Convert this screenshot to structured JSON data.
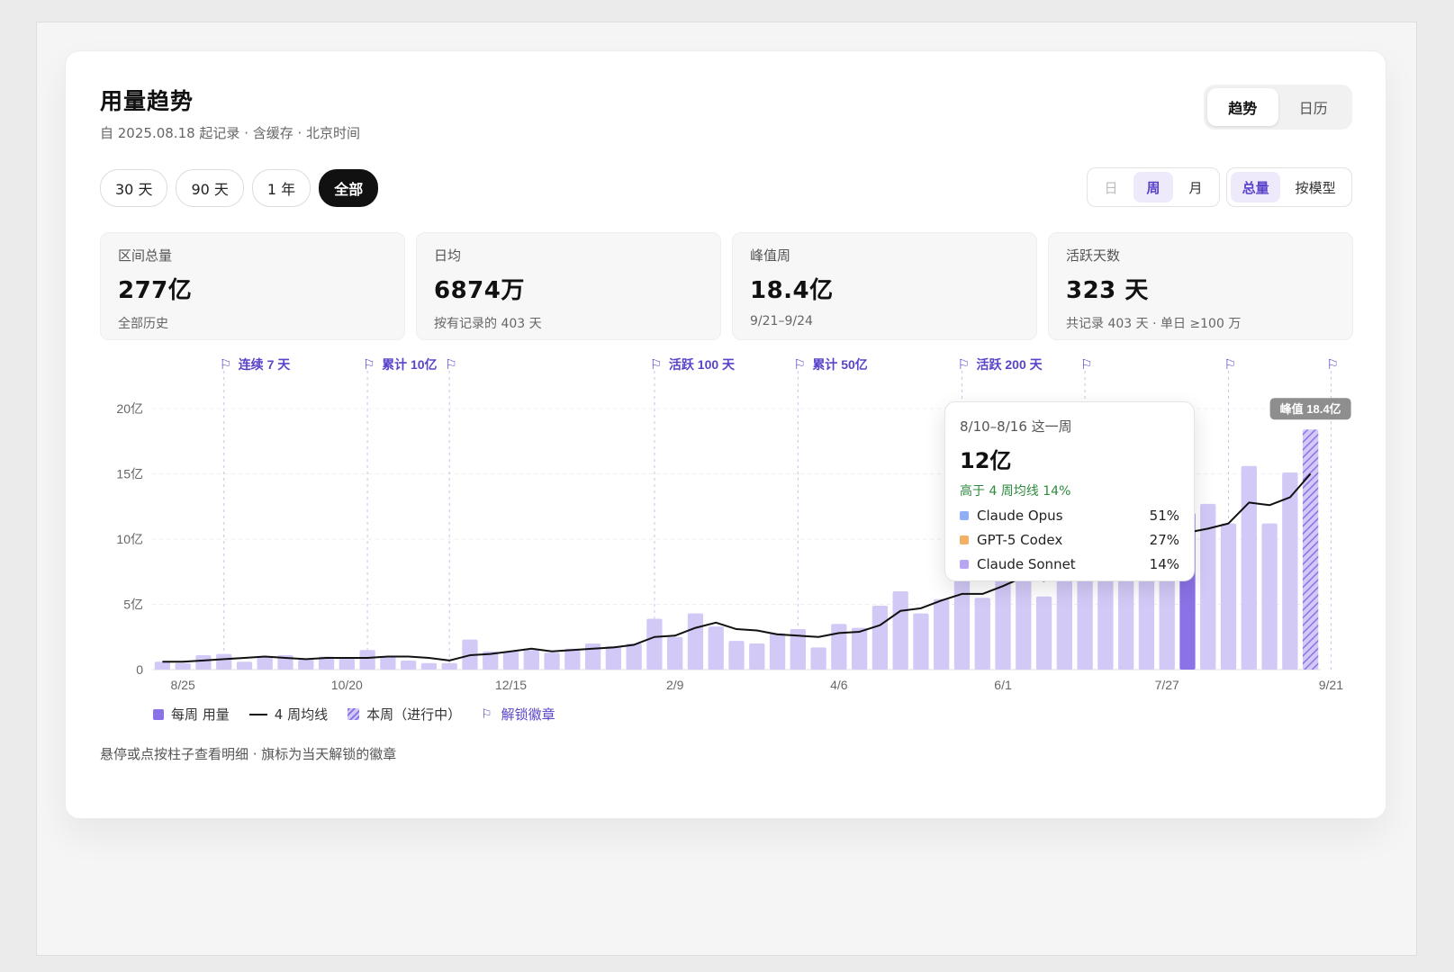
{
  "header": {
    "title": "用量趋势",
    "subtitle": "自 2025.08.18 起记录 · 含缓存 · 北京时间"
  },
  "view_toggle": [
    "趋势",
    "日历"
  ],
  "ranges": [
    "30 天",
    "90 天",
    "1 年",
    "全部"
  ],
  "granularity": [
    "日",
    "周",
    "月"
  ],
  "mode": [
    "总量",
    "按模型"
  ],
  "stats": [
    {
      "label": "区间总量",
      "value": "277亿",
      "note": "全部历史"
    },
    {
      "label": "日均",
      "value": "6874万",
      "note": "按有记录的 403 天"
    },
    {
      "label": "峰值周",
      "value": "18.4亿",
      "note": "9/21–9/24"
    },
    {
      "label": "活跃天数",
      "value": "323 天",
      "note": "共记录 403 天 · 单日 ≥100 万"
    }
  ],
  "tooltip": {
    "week": "8/10–8/16 这一周",
    "value": "12亿",
    "compare": "高于 4 周均线 14%",
    "rows": [
      {
        "name": "Claude Opus",
        "pct": "51%",
        "color": "#8fb0f5"
      },
      {
        "name": "GPT-5 Codex",
        "pct": "27%",
        "color": "#f2b266"
      },
      {
        "name": "Claude Sonnet",
        "pct": "14%",
        "color": "#b9a6f2"
      }
    ]
  },
  "legend": {
    "bars": "每周 用量",
    "avg": "4 周均线",
    "current": "本周（进行中）",
    "badge": "解锁徽章"
  },
  "footnote": "悬停或点按柱子查看明细 · 旗标为当天解锁的徽章",
  "colors": {
    "bar": "#d3c9f7",
    "bar_selected": "#8b72e6",
    "accent": "#5b43c9",
    "line": "#111111"
  },
  "chart_data": {
    "type": "bar",
    "unit": "亿",
    "y_tick_labels": [
      "0",
      "5亿",
      "10亿",
      "15亿",
      "20亿"
    ],
    "ylim": [
      0,
      20
    ],
    "x_tick_labels": [
      {
        "index": 1,
        "label": "8/25"
      },
      {
        "index": 9,
        "label": "10/20"
      },
      {
        "index": 17,
        "label": "12/15"
      },
      {
        "index": 25,
        "label": "2/9"
      },
      {
        "index": 33,
        "label": "4/6"
      },
      {
        "index": 41,
        "label": "6/1"
      },
      {
        "index": 49,
        "label": "7/27"
      },
      {
        "index": 57,
        "label": "9/21"
      }
    ],
    "series": [
      {
        "name": "每周 用量",
        "values": [
          0.6,
          0.5,
          1.1,
          1.2,
          0.6,
          1.0,
          1.1,
          0.8,
          1.0,
          0.9,
          1.5,
          1.0,
          0.7,
          0.5,
          0.5,
          2.3,
          1.4,
          1.4,
          1.5,
          1.3,
          1.6,
          2.0,
          1.8,
          2.0,
          3.9,
          2.5,
          4.3,
          3.3,
          2.2,
          2.0,
          2.8,
          3.1,
          1.7,
          3.5,
          3.2,
          4.9,
          6.0,
          4.3,
          5.4,
          7.1,
          5.5,
          7.3,
          7.5,
          5.6,
          8.1,
          9.0,
          9.3,
          9.2,
          9.5,
          9.0,
          12.0,
          12.7,
          11.2,
          15.6,
          11.2,
          15.1,
          18.4
        ]
      },
      {
        "name": "4 周均线",
        "values": [
          0.6,
          0.6,
          0.7,
          0.8,
          0.9,
          1.0,
          0.9,
          0.8,
          0.9,
          0.9,
          0.9,
          1.0,
          1.0,
          0.9,
          0.7,
          1.1,
          1.2,
          1.4,
          1.6,
          1.4,
          1.5,
          1.6,
          1.7,
          1.9,
          2.5,
          2.6,
          3.2,
          3.6,
          3.1,
          3.0,
          2.7,
          2.6,
          2.5,
          2.8,
          2.9,
          3.4,
          4.5,
          4.7,
          5.3,
          5.8,
          5.8,
          6.4,
          7.1,
          6.8,
          7.5,
          8.2,
          8.8,
          9.0,
          9.5,
          9.9,
          10.5,
          10.8,
          11.2,
          12.8,
          12.6,
          13.2,
          15.0
        ]
      }
    ],
    "selected_index": 50,
    "current_week_index": 56,
    "peak_label": "峰值 18.4亿",
    "badges": [
      {
        "index": 3,
        "label": "连续 7 天"
      },
      {
        "index": 10,
        "label": "累计 10亿"
      },
      {
        "index": 14,
        "label": ""
      },
      {
        "index": 24,
        "label": "活跃 100 天"
      },
      {
        "index": 31,
        "label": "累计 50亿"
      },
      {
        "index": 39,
        "label": "活跃 200 天"
      },
      {
        "index": 45,
        "label": ""
      },
      {
        "index": 52,
        "label": ""
      },
      {
        "index": 57,
        "label": ""
      }
    ]
  }
}
